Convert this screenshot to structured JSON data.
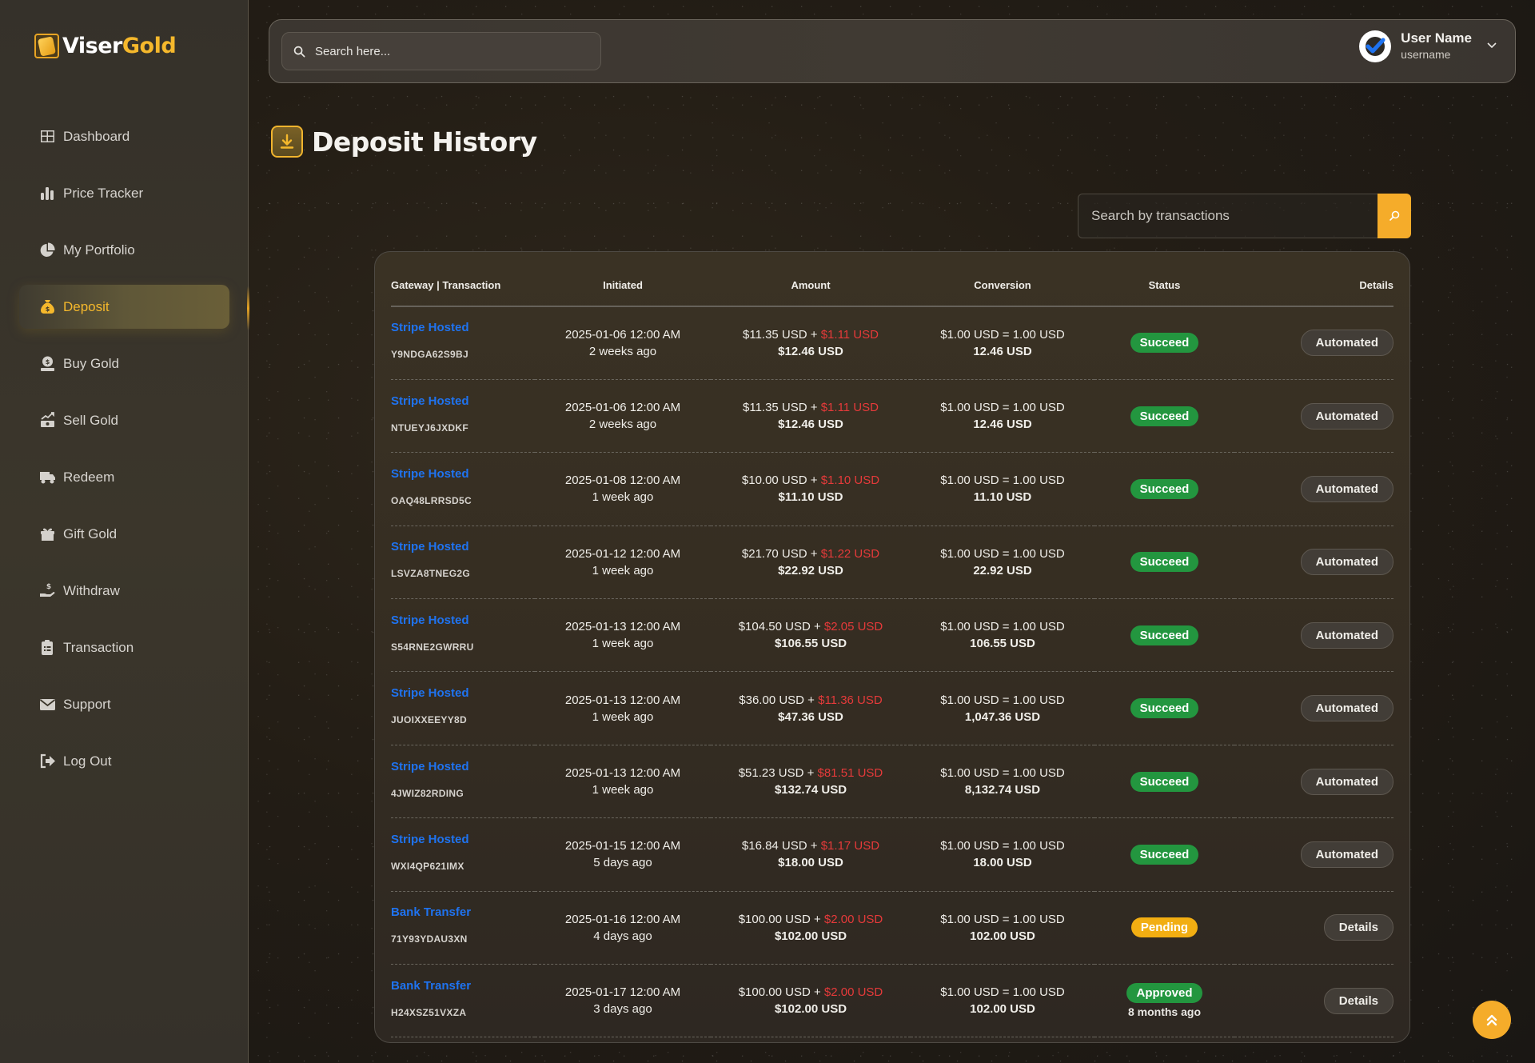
{
  "brand": {
    "part1": "Viser",
    "part2": "Gold"
  },
  "sidebar": {
    "items": [
      {
        "label": "Dashboard",
        "icon": "dashboard-icon",
        "active": false
      },
      {
        "label": "Price Tracker",
        "icon": "bar-chart-icon",
        "active": false
      },
      {
        "label": "My Portfolio",
        "icon": "pie-chart-icon",
        "active": false
      },
      {
        "label": "Deposit",
        "icon": "money-bag-icon",
        "active": true
      },
      {
        "label": "Buy Gold",
        "icon": "coin-hand-icon",
        "active": false
      },
      {
        "label": "Sell Gold",
        "icon": "money-trend-icon",
        "active": false
      },
      {
        "label": "Redeem",
        "icon": "truck-icon",
        "active": false
      },
      {
        "label": "Gift Gold",
        "icon": "gift-icon",
        "active": false
      },
      {
        "label": "Withdraw",
        "icon": "hand-dollar-icon",
        "active": false
      },
      {
        "label": "Transaction",
        "icon": "clipboard-list-icon",
        "active": false
      },
      {
        "label": "Support",
        "icon": "envelope-icon",
        "active": false
      },
      {
        "label": "Log Out",
        "icon": "logout-icon",
        "active": false
      }
    ]
  },
  "topbar": {
    "search_placeholder": "Search here...",
    "user": {
      "name": "User Name",
      "handle": "username"
    }
  },
  "page": {
    "title": "Deposit History",
    "tx_search_placeholder": "Search by transactions"
  },
  "table": {
    "headers": [
      "Gateway | Transaction",
      "Initiated",
      "Amount",
      "Conversion",
      "Status",
      "Details"
    ],
    "rows": [
      {
        "gateway": "Stripe Hosted",
        "trx": "Y9NDGA62S9BJ",
        "date": "2025-01-06 12:00 AM",
        "ago": "2 weeks ago",
        "amount": "$11.35 USD",
        "plus": " + ",
        "charge": "$1.11 USD",
        "total": "$12.46 USD",
        "rate": "$1.00 USD = 1.00 USD",
        "converted": "12.46 USD",
        "status": "Succeed",
        "status_type": "success",
        "status_sub": "",
        "action": "Automated"
      },
      {
        "gateway": "Stripe Hosted",
        "trx": "NTUEYJ6JXDKF",
        "date": "2025-01-06 12:00 AM",
        "ago": "2 weeks ago",
        "amount": "$11.35 USD",
        "plus": " + ",
        "charge": "$1.11 USD",
        "total": "$12.46 USD",
        "rate": "$1.00 USD = 1.00 USD",
        "converted": "12.46 USD",
        "status": "Succeed",
        "status_type": "success",
        "status_sub": "",
        "action": "Automated"
      },
      {
        "gateway": "Stripe Hosted",
        "trx": "OAQ48LRRSD5C",
        "date": "2025-01-08 12:00 AM",
        "ago": "1 week ago",
        "amount": "$10.00 USD",
        "plus": " + ",
        "charge": "$1.10 USD",
        "total": "$11.10 USD",
        "rate": "$1.00 USD = 1.00 USD",
        "converted": "11.10 USD",
        "status": "Succeed",
        "status_type": "success",
        "status_sub": "",
        "action": "Automated"
      },
      {
        "gateway": "Stripe Hosted",
        "trx": "LSVZA8TNEG2G",
        "date": "2025-01-12 12:00 AM",
        "ago": "1 week ago",
        "amount": "$21.70 USD",
        "plus": " + ",
        "charge": "$1.22 USD",
        "total": "$22.92 USD",
        "rate": "$1.00 USD = 1.00 USD",
        "converted": "22.92 USD",
        "status": "Succeed",
        "status_type": "success",
        "status_sub": "",
        "action": "Automated"
      },
      {
        "gateway": "Stripe Hosted",
        "trx": "S54RNE2GWRRU",
        "date": "2025-01-13 12:00 AM",
        "ago": "1 week ago",
        "amount": "$104.50 USD",
        "plus": " + ",
        "charge": "$2.05 USD",
        "total": "$106.55 USD",
        "rate": "$1.00 USD = 1.00 USD",
        "converted": "106.55 USD",
        "status": "Succeed",
        "status_type": "success",
        "status_sub": "",
        "action": "Automated"
      },
      {
        "gateway": "Stripe Hosted",
        "trx": "JUOIXXEEYY8D",
        "date": "2025-01-13 12:00 AM",
        "ago": "1 week ago",
        "amount": "$36.00 USD",
        "plus": " + ",
        "charge": "$11.36 USD",
        "total": "$47.36 USD",
        "rate": "$1.00 USD = 1.00 USD",
        "converted": "1,047.36 USD",
        "status": "Succeed",
        "status_type": "success",
        "status_sub": "",
        "action": "Automated"
      },
      {
        "gateway": "Stripe Hosted",
        "trx": "4JWIZ82RDING",
        "date": "2025-01-13 12:00 AM",
        "ago": "1 week ago",
        "amount": "$51.23 USD",
        "plus": " + ",
        "charge": "$81.51 USD",
        "total": "$132.74 USD",
        "rate": "$1.00 USD = 1.00 USD",
        "converted": "8,132.74 USD",
        "status": "Succeed",
        "status_type": "success",
        "status_sub": "",
        "action": "Automated"
      },
      {
        "gateway": "Stripe Hosted",
        "trx": "WXI4QP621IMX",
        "date": "2025-01-15 12:00 AM",
        "ago": "5 days ago",
        "amount": "$16.84 USD",
        "plus": " + ",
        "charge": "$1.17 USD",
        "total": "$18.00 USD",
        "rate": "$1.00 USD = 1.00 USD",
        "converted": "18.00 USD",
        "status": "Succeed",
        "status_type": "success",
        "status_sub": "",
        "action": "Automated"
      },
      {
        "gateway": "Bank Transfer",
        "trx": "71Y93YDAU3XN",
        "date": "2025-01-16 12:00 AM",
        "ago": "4 days ago",
        "amount": "$100.00 USD",
        "plus": " + ",
        "charge": "$2.00 USD",
        "total": "$102.00 USD",
        "rate": "$1.00 USD = 1.00 USD",
        "converted": "102.00 USD",
        "status": "Pending",
        "status_type": "pending",
        "status_sub": "",
        "action": "Details"
      },
      {
        "gateway": "Bank Transfer",
        "trx": "H24XSZ51VXZA",
        "date": "2025-01-17 12:00 AM",
        "ago": "3 days ago",
        "amount": "$100.00 USD",
        "plus": " + ",
        "charge": "$2.00 USD",
        "total": "$102.00 USD",
        "rate": "$1.00 USD = 1.00 USD",
        "converted": "102.00 USD",
        "status": "Approved",
        "status_type": "success",
        "status_sub": "8 months ago",
        "action": "Details"
      }
    ]
  },
  "colors": {
    "accent": "#f5ac2a",
    "link": "#1f73f0",
    "charge": "#e53a3a",
    "success": "#23963f",
    "pending": "#f2ae12"
  }
}
